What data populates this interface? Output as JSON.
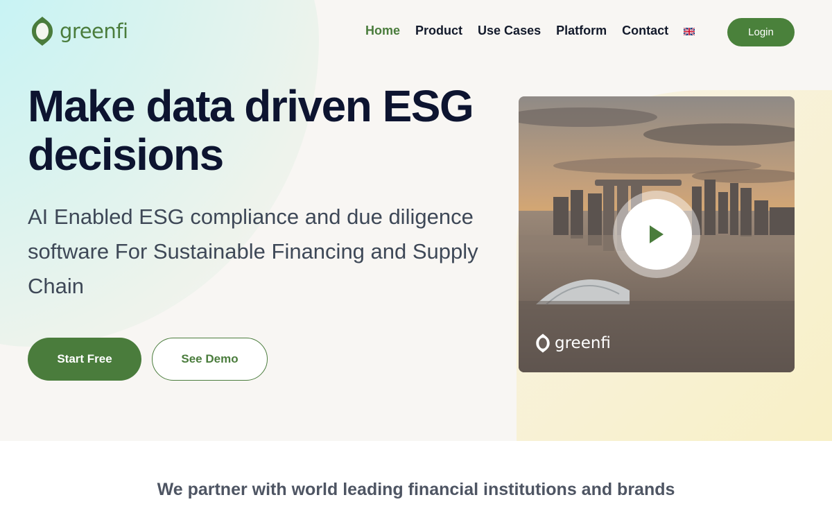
{
  "brand": {
    "name": "greenfi",
    "color": "#4a7c3c"
  },
  "nav": {
    "links": [
      {
        "label": "Home",
        "active": true
      },
      {
        "label": "Product",
        "active": false
      },
      {
        "label": "Use Cases",
        "active": false
      },
      {
        "label": "Platform",
        "active": false
      },
      {
        "label": "Contact",
        "active": false
      }
    ],
    "language_icon": "uk-flag-icon",
    "login_label": "Login"
  },
  "hero": {
    "headline": "Make data driven ESG decisions",
    "subheadline": "AI Enabled ESG compliance and due diligence software For Sustainable Financing and Supply Chain",
    "primary_cta": "Start Free",
    "secondary_cta": "See Demo",
    "video": {
      "play_icon": "play-icon",
      "watermark": "greenfi"
    }
  },
  "partners": {
    "heading": "We partner with world leading financial institutions and brands"
  },
  "colors": {
    "accent": "#4a7c3c",
    "headline": "#0d1430",
    "body_text": "#3e4857",
    "hero_bg": "#f8f6f3"
  }
}
